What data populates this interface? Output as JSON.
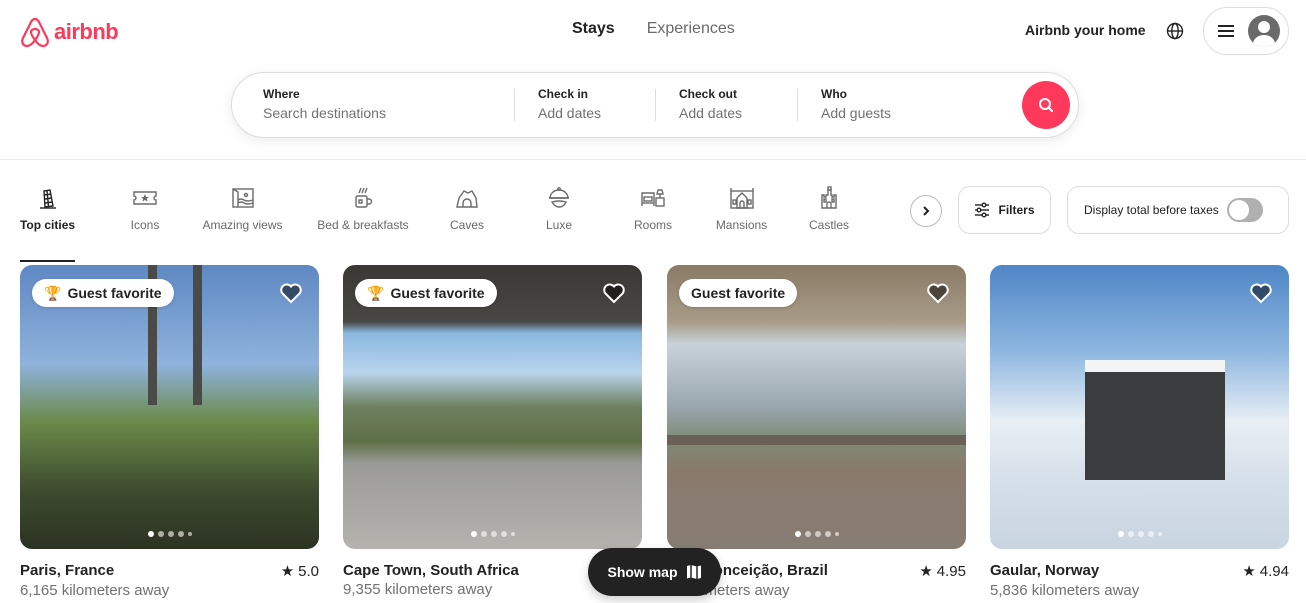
{
  "brand": {
    "name": "airbnb",
    "color": "#ff385c"
  },
  "nav": {
    "tabs": [
      {
        "label": "Stays",
        "active": true
      },
      {
        "label": "Experiences",
        "active": false
      }
    ],
    "host_link": "Airbnb your home"
  },
  "search": {
    "where": {
      "label": "Where",
      "placeholder": "Search destinations"
    },
    "check_in": {
      "label": "Check in",
      "placeholder": "Add dates"
    },
    "check_out": {
      "label": "Check out",
      "placeholder": "Add dates"
    },
    "who": {
      "label": "Who",
      "placeholder": "Add guests"
    }
  },
  "categories": [
    {
      "label": "Top cities",
      "icon": "leaning-tower-icon",
      "active": true
    },
    {
      "label": "Icons",
      "icon": "ticket-star-icon",
      "active": false
    },
    {
      "label": "Amazing views",
      "icon": "picture-view-icon",
      "active": false
    },
    {
      "label": "Bed & breakfasts",
      "icon": "mug-icon",
      "active": false
    },
    {
      "label": "Caves",
      "icon": "cave-icon",
      "active": false
    },
    {
      "label": "Luxe",
      "icon": "cloche-icon",
      "active": false
    },
    {
      "label": "Rooms",
      "icon": "bed-lamp-icon",
      "active": false
    },
    {
      "label": "Mansions",
      "icon": "mansion-icon",
      "active": false
    },
    {
      "label": "Castles",
      "icon": "castle-icon",
      "active": false
    }
  ],
  "filters": {
    "label": "Filters"
  },
  "taxes_toggle": {
    "label": "Display total before taxes",
    "on": false
  },
  "listings": [
    {
      "badge": "Guest favorite",
      "badge_trophy": true,
      "location": "Paris, France",
      "rating": "5.0",
      "distance": "6,165 kilometers away"
    },
    {
      "badge": "Guest favorite",
      "badge_trophy": true,
      "location": "Cape Town, South Africa",
      "rating": "",
      "distance": "9,355 kilometers away"
    },
    {
      "badge": "Guest favorite",
      "badge_trophy": false,
      "location": "…va Conceição, Brazil",
      "rating": "4.95",
      "distance": "…kilometers away"
    },
    {
      "badge": "",
      "badge_trophy": false,
      "location": "Gaular, Norway",
      "rating": "4.94",
      "distance": "5,836 kilometers away"
    }
  ],
  "show_map": {
    "label": "Show map"
  }
}
